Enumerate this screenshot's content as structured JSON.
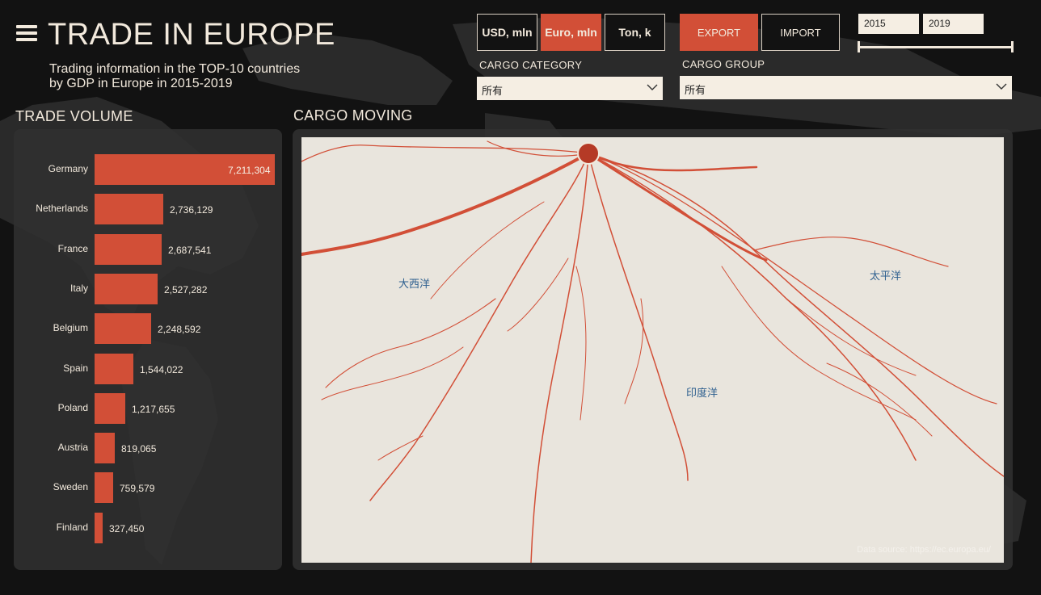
{
  "header": {
    "title": "TRADE IN EUROPE",
    "subtitle_line1": "Trading information in the TOP-10 countries",
    "subtitle_line2": "by GDP in Europe in 2015-2019"
  },
  "units": {
    "options": [
      "USD, mln",
      "Euro, mln",
      "Ton, k"
    ],
    "selected": "Euro, mln"
  },
  "flow": {
    "options": [
      "EXPORT",
      "IMPORT"
    ],
    "selected": "EXPORT"
  },
  "filters": {
    "cargo_category_label": "CARGO CATEGORY",
    "cargo_category_value": "所有",
    "cargo_group_label": "CARGO GROUP",
    "cargo_group_value": "所有"
  },
  "years": {
    "start": "2015",
    "end": "2019",
    "range": [
      2015,
      2019
    ]
  },
  "sections": {
    "trade_volume": "TRADE VOLUME",
    "cargo_moving": "CARGO MOVING"
  },
  "map": {
    "oceans": [
      "大西洋",
      "太平洋",
      "印度洋"
    ],
    "source": "Data source: https://ec.europa.eu/"
  },
  "colors": {
    "accent": "#d24f37",
    "background": "#121212",
    "panel": "#303030",
    "map_land": "#e9e5dd",
    "ocean_label": "#2d5f8f",
    "text": "#f2e9dc"
  },
  "chart_data": {
    "type": "bar",
    "orientation": "horizontal",
    "title": "TRADE VOLUME",
    "categories": [
      "Germany",
      "Netherlands",
      "France",
      "Italy",
      "Belgium",
      "Spain",
      "Poland",
      "Austria",
      "Sweden",
      "Finland"
    ],
    "values": [
      7211304,
      2736129,
      2687541,
      2527282,
      2248592,
      1544022,
      1217655,
      819065,
      759579,
      327450
    ],
    "value_labels": [
      "7,211,304",
      "2,736,129",
      "2,687,541",
      "2,527,282",
      "2,248,592",
      "1,544,022",
      "1,217,655",
      "819,065",
      "759,579",
      "327,450"
    ],
    "color": "#d24f37"
  }
}
